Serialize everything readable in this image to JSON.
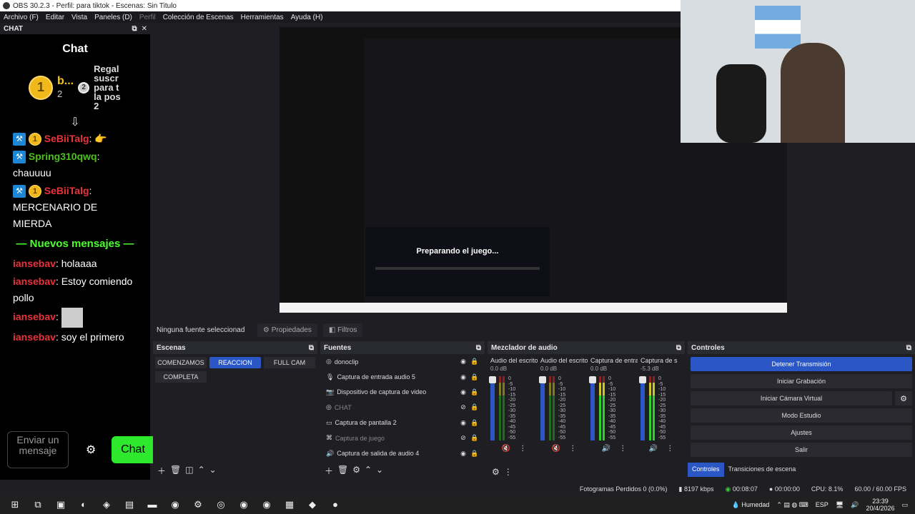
{
  "window": {
    "title": "OBS 30.2.3 - Perfil: para tiktok - Escenas: Sin Titulo"
  },
  "menu": [
    {
      "label": "Archivo (F)"
    },
    {
      "label": "Editar"
    },
    {
      "label": "Vista"
    },
    {
      "label": "Paneles (D)"
    },
    {
      "label": "Perfil",
      "disabled": true
    },
    {
      "label": "Colección de Escenas"
    },
    {
      "label": "Herramientas"
    },
    {
      "label": "Ayuda (H)"
    }
  ],
  "chat_dock": {
    "header": "CHAT",
    "title": "Chat",
    "gift_user": "b...",
    "gift_count": "2",
    "gift_rank": "2",
    "gift_text": "Regal suscr para t la pos 2",
    "messages": [
      {
        "user": "SeBiiTalg",
        "text": ":"
      },
      {
        "user": "Spring310qwq",
        "text": ": chauuuu"
      },
      {
        "user": "SeBiiTalg",
        "text": ": MERCENARIO DE MIERDA"
      }
    ],
    "new_messages": "Nuevos mensajes",
    "new": [
      {
        "user": "iansebav",
        "text": ": holaaaa"
      },
      {
        "user": "iansebav",
        "text": ": Estoy comiendo pollo"
      },
      {
        "user": "iansebav",
        "text": ":"
      },
      {
        "user": "iansebav",
        "text": ": soy el primero"
      }
    ],
    "input_placeholder": "Enviar un mensaje",
    "send_label": "Chat"
  },
  "preview": {
    "loading_text": "Preparando el juego..."
  },
  "source_bar": {
    "none_selected": "Ninguna fuente seleccionad",
    "properties": "Propiedades",
    "filters": "Filtros"
  },
  "scenes": {
    "title": "Escenas",
    "items": [
      {
        "label": "COMENZAMOS",
        "active": false
      },
      {
        "label": "REACCION",
        "active": true
      },
      {
        "label": "FULL CAM",
        "active": false
      },
      {
        "label": "COMPLETA",
        "active": false
      }
    ]
  },
  "sources": {
    "title": "Fuentes",
    "items": [
      {
        "label": "donoclip",
        "hidden": false
      },
      {
        "label": "Captura de entrada audio 5",
        "hidden": false
      },
      {
        "label": "Dispositivo de captura de video",
        "hidden": false
      },
      {
        "label": "CHAT",
        "hidden": true
      },
      {
        "label": "Captura de pantalla 2",
        "hidden": false
      },
      {
        "label": "Captura de juego",
        "hidden": true
      },
      {
        "label": "Captura de salida de audio 4",
        "hidden": false
      }
    ]
  },
  "mixer": {
    "title": "Mezclador de audio",
    "channels": [
      {
        "name": "Audio del escrito",
        "db": "0.0 dB",
        "muted": true
      },
      {
        "name": "Audio del escrito",
        "db": "0.0 dB",
        "muted": true
      },
      {
        "name": "Captura de entrad",
        "db": "0.0 dB",
        "muted": false
      },
      {
        "name": "Captura de s",
        "db": "-5.3 dB",
        "muted": false
      }
    ],
    "ticks": [
      "0",
      "-5",
      "-10",
      "-15",
      "-20",
      "-25",
      "-30",
      "-35",
      "-40",
      "-45",
      "-50",
      "-55",
      "-60"
    ]
  },
  "controls": {
    "title": "Controles",
    "stop_stream": "Detener Transmisión",
    "start_record": "Iniciar Grabación",
    "virtual_cam": "Iniciar Cámara Virtual",
    "studio_mode": "Modo Estudio",
    "settings": "Ajustes",
    "exit": "Salir",
    "tab_controls": "Controles",
    "tab_transitions": "Transiciones de escena"
  },
  "status": {
    "dropped": "Fotogramas Perdidos 0 (0.0%)",
    "kbps": "8197 kbps",
    "stream_time": "00:08:07",
    "rec_time": "00:00:00",
    "cpu": "CPU: 8.1%",
    "fps": "60.00 / 60.00 FPS"
  },
  "taskbar": {
    "weather": "Humedad",
    "lang": "ESP",
    "time": "23:39",
    "date": "20/4/2026"
  }
}
